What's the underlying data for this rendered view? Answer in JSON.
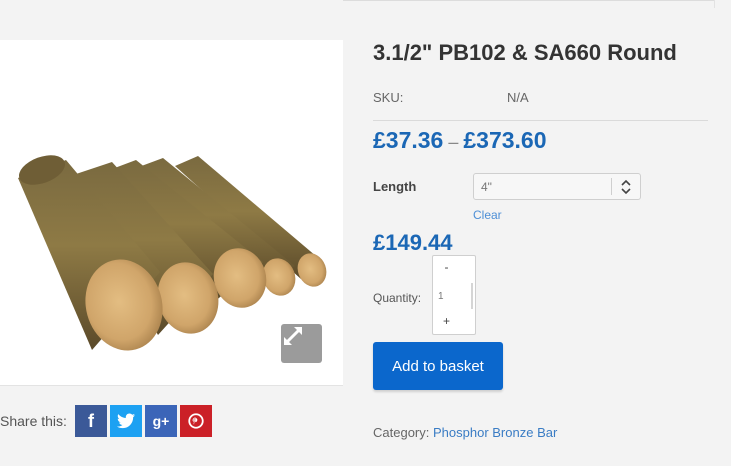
{
  "product": {
    "title": "3.1/2\" PB102 & SA660 Round",
    "sku_label": "SKU:",
    "sku_value": "N/A",
    "price_min": "£37.36",
    "price_separator": "–",
    "price_max": "£373.60",
    "variation_price": "£149.44"
  },
  "options": {
    "length_label": "Length",
    "length_value": "4\"",
    "clear_label": "Clear"
  },
  "quantity": {
    "label": "Quantity:",
    "value": "1",
    "minus": "-",
    "plus": "+"
  },
  "actions": {
    "add_to_basket": "Add to basket"
  },
  "meta": {
    "category_label": "Category:",
    "category_value": "Phosphor Bronze Bar"
  },
  "share": {
    "label": "Share this:",
    "facebook_glyph": "f",
    "googleplus_glyph": "g+"
  },
  "colors": {
    "accent_blue": "#1b67b5",
    "button_blue": "#0b67cc",
    "facebook": "#3b5998",
    "twitter": "#1da1f2",
    "googleplus": "#3b65b8",
    "pinterest": "#cb2027"
  },
  "icons": {
    "zoom": "expand-arrows-icon",
    "select": "chevron-up-down-icon"
  }
}
